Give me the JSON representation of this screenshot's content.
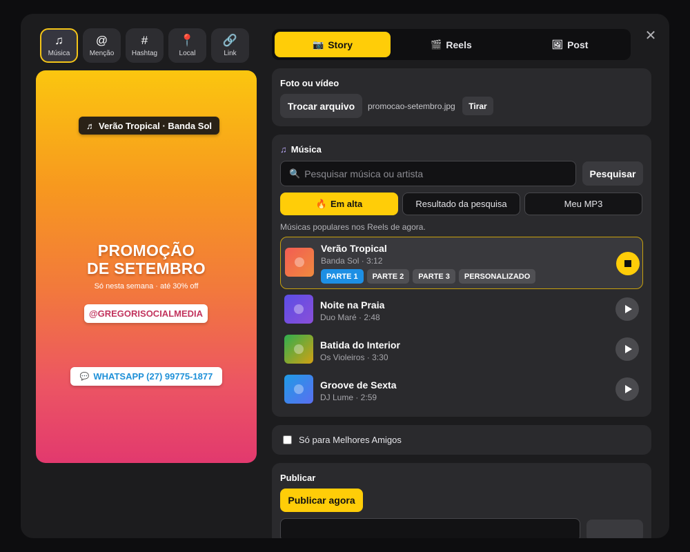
{
  "stickers": [
    {
      "label": "Música",
      "icon": "♫",
      "icon_name": "music-note-icon",
      "active": true
    },
    {
      "label": "Menção",
      "icon": "@",
      "icon_name": "at-sign-icon",
      "active": false
    },
    {
      "label": "Hashtag",
      "icon": "#",
      "icon_name": "hashtag-icon",
      "active": false
    },
    {
      "label": "Local",
      "icon": "📍",
      "icon_name": "location-pin-icon",
      "active": false
    },
    {
      "label": "Link",
      "icon": "🔗",
      "icon_name": "link-icon",
      "active": false
    }
  ],
  "preview": {
    "music_chip_icon": "♬",
    "music_chip": "Verão Tropical · Banda Sol",
    "title_line1": "PROMOÇÃO",
    "title_line2": "DE SETEMBRO",
    "subtitle": "Só nesta semana · até 30% off",
    "handle": "@GREGORISOCIALMEDIA",
    "whatsapp_icon": "💬",
    "whatsapp": "WHATSAPP (27) 99775-1877",
    "gradient_colors": [
      "#fbc60f",
      "#f7981f",
      "#f27a3b",
      "#ec5563",
      "#e2396e"
    ]
  },
  "tabs": [
    {
      "label": "Story",
      "icon": "📷",
      "icon_name": "camera-icon",
      "active": true
    },
    {
      "label": "Reels",
      "icon": "🎬",
      "icon_name": "clapperboard-icon",
      "active": false
    },
    {
      "label": "Post",
      "icon": "🖼",
      "icon_name": "image-icon",
      "active": false
    }
  ],
  "close_icon": "✕",
  "media": {
    "title": "Foto ou vídeo",
    "swap_label": "Trocar arquivo",
    "file_name": "promocao-setembro.jpg",
    "remove_label": "Tirar"
  },
  "music": {
    "title_icon": "♫",
    "title": "Música",
    "search_icon": "🔍",
    "search_placeholder": "Pesquisar música ou artista",
    "search_button": "Pesquisar",
    "filters": [
      {
        "label": "Em alta",
        "icon": "🔥",
        "active": true
      },
      {
        "label": "Resultado da pesquisa",
        "icon": "",
        "active": false
      },
      {
        "label": "Meu MP3",
        "icon": "",
        "active": false
      }
    ],
    "hint": "Músicas populares nos Reels de agora.",
    "tracks": [
      {
        "name": "Verão Tropical",
        "meta": "Banda Sol · 3:12",
        "playing": true,
        "cover_from": "#f25c54",
        "cover_to": "#f08a3e"
      },
      {
        "name": "Noite na Praia",
        "meta": "Duo Maré · 2:48",
        "playing": false,
        "cover_from": "#5b4ee6",
        "cover_to": "#8a4fd8"
      },
      {
        "name": "Batida do Interior",
        "meta": "Os Violeiros · 3:30",
        "playing": false,
        "cover_from": "#2fae4f",
        "cover_to": "#d2a114"
      },
      {
        "name": "Groove de Sexta",
        "meta": "DJ Lume · 2:59",
        "playing": false,
        "cover_from": "#1f9be6",
        "cover_to": "#5a6ff0"
      }
    ],
    "parts": [
      {
        "label": "PARTE 1",
        "active": true
      },
      {
        "label": "PARTE 2",
        "active": false
      },
      {
        "label": "PARTE 3",
        "active": false
      },
      {
        "label": "PERSONALIZADO",
        "active": false
      }
    ]
  },
  "close_friends": {
    "label": "Só para Melhores Amigos",
    "checked": false
  },
  "publish": {
    "title": "Publicar",
    "button": "Publicar agora"
  },
  "colors": {
    "accent": "#ffcd08",
    "part_active": "#1d8fe4",
    "card": "#2a2a2d",
    "modal": "#1c1c1e"
  }
}
